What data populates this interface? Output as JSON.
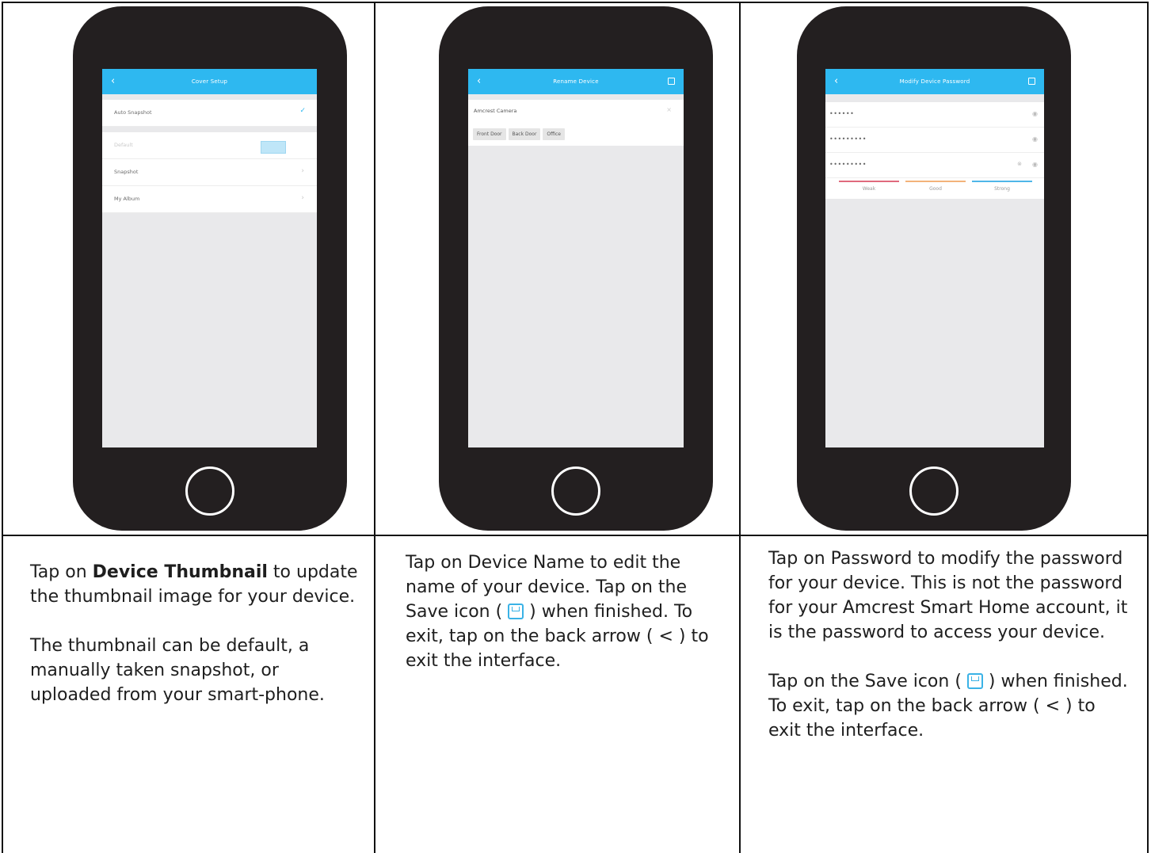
{
  "panels": [
    {
      "screen_title": "Cover Setup",
      "rows": [
        "Auto Snapshot",
        "Default",
        "Snapshot",
        "My Album"
      ]
    },
    {
      "screen_title": "Rename Device",
      "device_name": "Amcrest Camera",
      "tags": [
        "Front Door",
        "Back Door",
        "Office"
      ]
    },
    {
      "screen_title": "Modify Device Password",
      "password_rows": [
        "••••••",
        "•••••••••",
        "•••••••••"
      ],
      "strength_labels": [
        "Weak",
        "Good",
        "Strong"
      ],
      "strength_colors": [
        "#e06a7d",
        "#f3b37a",
        "#4fb6e8"
      ]
    }
  ],
  "captions": {
    "col1": {
      "p1_pre": "Tap on ",
      "p1_bold": "Device Thumbnail",
      "p1_post": " to update the thumbnail image for your device.",
      "p2": "The thumbnail can be default, a manually taken snapshot, or uploaded from your smart-phone."
    },
    "col2": {
      "p1_a": "Tap on Device Name to edit the name of your device. Tap on the Save icon ( ",
      "p1_b": " ) when finished. To exit, tap on the back arrow ( < ) to exit the interface."
    },
    "col3": {
      "p1": "Tap on Password to modify the password for your device. This is not the password for your Amcrest Smart Home account, it is the password to access your device.",
      "p2_a": "Tap on the Save icon ( ",
      "p2_b": " ) when finished. To exit, tap on the back arrow ( < ) to exit the interface."
    }
  },
  "icons": {
    "back": "‹",
    "chevron": "›",
    "check": "✓",
    "eye": "◉",
    "clear": "⊗",
    "close": "×"
  }
}
